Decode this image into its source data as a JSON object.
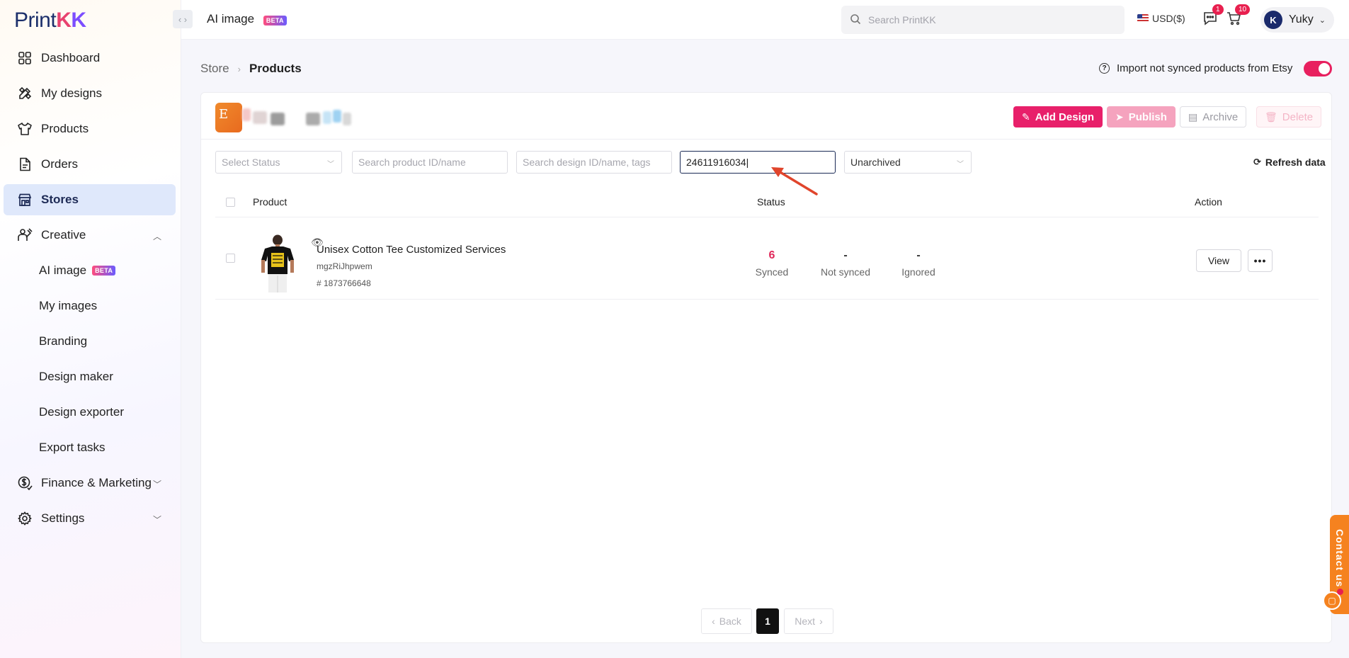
{
  "brand": {
    "logo_part1": "Print",
    "logo_part2": "K",
    "logo_part3": "K"
  },
  "sidebar": {
    "items": [
      {
        "label": "Dashboard",
        "icon": "dashboard-icon"
      },
      {
        "label": "My designs",
        "icon": "pencil-ruler-icon"
      },
      {
        "label": "Products",
        "icon": "tshirt-icon"
      },
      {
        "label": "Orders",
        "icon": "document-icon"
      },
      {
        "label": "Stores",
        "icon": "store-icon",
        "active": true
      },
      {
        "label": "Creative",
        "icon": "creative-icon",
        "expanded": true
      }
    ],
    "creative_sub": [
      {
        "label": "AI image",
        "badge": "BETA"
      },
      {
        "label": "My images"
      },
      {
        "label": "Branding"
      },
      {
        "label": "Design maker"
      },
      {
        "label": "Design exporter"
      },
      {
        "label": "Export tasks"
      }
    ],
    "bottom_items": [
      {
        "label": "Finance & Marketing",
        "icon": "finance-icon"
      },
      {
        "label": "Settings",
        "icon": "gear-icon"
      }
    ]
  },
  "topbar": {
    "title": "AI image",
    "title_badge": "BETA",
    "search_placeholder": "Search PrintKK",
    "currency": "USD($)",
    "messages_count": "1",
    "cart_count": "10",
    "user_initial": "K",
    "user_name": "Yuky"
  },
  "breadcrumb": {
    "parent": "Store",
    "current": "Products"
  },
  "import_toggle": {
    "label": "Import not synced products from Etsy",
    "on": true
  },
  "store": {
    "logo_letter": "E"
  },
  "actions": {
    "add_design": "Add Design",
    "publish": "Publish",
    "archive": "Archive",
    "delete": "Delete"
  },
  "filters": {
    "status_placeholder": "Select Status",
    "product_placeholder": "Search product ID/name",
    "design_placeholder": "Search design ID/name, tags",
    "etsy_id_value": "24611916034",
    "archive_value": "Unarchived",
    "refresh_label": "Refresh data"
  },
  "table": {
    "headers": {
      "product": "Product",
      "status": "Status",
      "action": "Action"
    },
    "rows": [
      {
        "name": "Unisex Cotton Tee Customized Services",
        "sku": "mgzRiJhpwem",
        "id": "# 1873766648",
        "synced": "6",
        "synced_label": "Synced",
        "not_synced": "-",
        "not_synced_label": "Not synced",
        "ignored": "-",
        "ignored_label": "Ignored",
        "view_label": "View",
        "more_label": "•••"
      }
    ]
  },
  "pagination": {
    "back": "Back",
    "current": "1",
    "next": "Next"
  },
  "contact": {
    "label": "Contact us"
  },
  "colors": {
    "accent": "#e8206a",
    "active_nav_bg": "#dfe8fb",
    "contact": "#f5821f",
    "annotation_arrow": "#e0452c"
  }
}
